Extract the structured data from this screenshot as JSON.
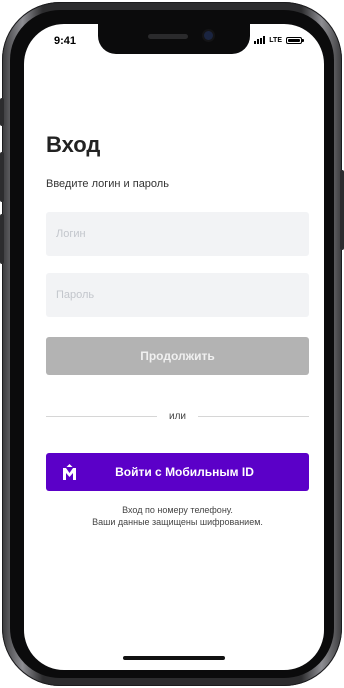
{
  "status_bar": {
    "time": "9:41",
    "network": "LTE"
  },
  "login": {
    "title": "Вход",
    "subtitle": "Введите логин и пароль",
    "login_placeholder": "Логин",
    "password_placeholder": "Пароль",
    "continue_label": "Продолжить",
    "divider_label": "или",
    "mobile_id_label": "Войти с Мобильным ID",
    "mobile_id_icon": "mobile-id-logo-icon",
    "note_line1": "Вход по номеру телефону.",
    "note_line2": "Ваши данные защищены шифрованием."
  },
  "colors": {
    "accent": "#5b00c8",
    "disabled_button": "#b3b3b3",
    "field_background": "#f2f3f5"
  }
}
